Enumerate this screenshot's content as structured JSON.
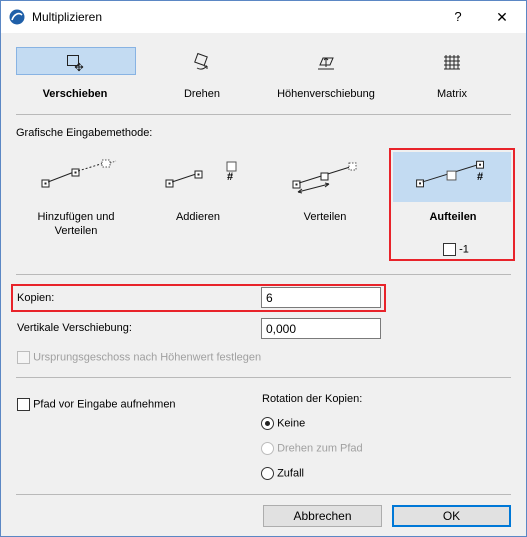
{
  "window": {
    "title": "Multiplizieren",
    "help": "?",
    "close": "✕"
  },
  "tabs": [
    {
      "label": "Verschieben",
      "icon": "move-icon",
      "selected": true
    },
    {
      "label": "Drehen",
      "icon": "rotate-icon",
      "selected": false
    },
    {
      "label": "Höhenverschiebung",
      "icon": "elevate-icon",
      "selected": false
    },
    {
      "label": "Matrix",
      "icon": "matrix-icon",
      "selected": false
    }
  ],
  "input_method": {
    "title": "Grafische Eingabemethode:",
    "options": [
      {
        "label": "Hinzufügen und Verteilen",
        "selected": false
      },
      {
        "label": "Addieren",
        "selected": false,
        "symbol": "#"
      },
      {
        "label": "Verteilen",
        "selected": false
      },
      {
        "label": "Aufteilen",
        "selected": true,
        "symbol": "#"
      }
    ],
    "minus_one": {
      "label": "-1",
      "checked": false
    }
  },
  "copies": {
    "label": "Kopien:",
    "value": "6"
  },
  "vertical_offset": {
    "label": "Vertikale Verschiebung:",
    "value": "0,000"
  },
  "origin_story": {
    "label": "Ursprungsgeschoss nach Höhenwert festlegen",
    "checked": false,
    "disabled": true
  },
  "record_path": {
    "label": "Pfad vor Eingabe aufnehmen",
    "checked": false
  },
  "rotation": {
    "title": "Rotation der Kopien:",
    "options": [
      {
        "label": "Keine",
        "checked": true,
        "disabled": false
      },
      {
        "label": "Drehen zum Pfad",
        "checked": false,
        "disabled": true
      },
      {
        "label": "Zufall",
        "checked": false,
        "disabled": false
      }
    ]
  },
  "buttons": {
    "cancel": "Abbrechen",
    "ok": "OK"
  },
  "colors": {
    "highlight": "#c3dbf2",
    "annotation_red": "#e8232a",
    "default_button_border": "#0078d7"
  }
}
